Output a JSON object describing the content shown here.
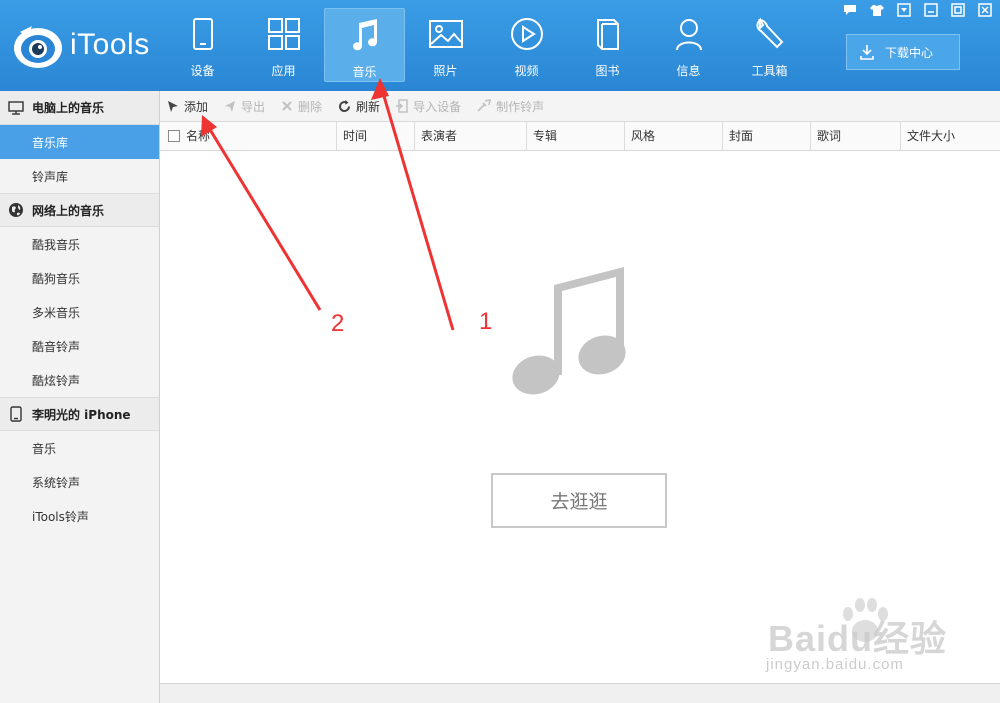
{
  "app": {
    "logo_text": "iTools"
  },
  "nav": [
    {
      "label": "设备",
      "icon": "device-icon"
    },
    {
      "label": "应用",
      "icon": "apps-icon"
    },
    {
      "label": "音乐",
      "icon": "music-note-icon",
      "active": true
    },
    {
      "label": "照片",
      "icon": "photo-icon"
    },
    {
      "label": "视频",
      "icon": "video-play-icon"
    },
    {
      "label": "图书",
      "icon": "book-icon"
    },
    {
      "label": "信息",
      "icon": "user-icon"
    },
    {
      "label": "工具箱",
      "icon": "wrench-icon"
    }
  ],
  "download_center": {
    "label": "下载中心",
    "icon": "download-icon"
  },
  "window_controls": [
    "feedback-icon",
    "skin-icon",
    "menu-icon",
    "minimize-icon",
    "maximize-icon",
    "close-icon"
  ],
  "sidebar": {
    "sections": [
      {
        "title": "电脑上的音乐",
        "icon": "monitor-icon",
        "items": [
          "音乐库",
          "铃声库"
        ],
        "active_index": 0
      },
      {
        "title": "网络上的音乐",
        "icon": "globe-icon",
        "items": [
          "酷我音乐",
          "酷狗音乐",
          "多米音乐",
          "酷音铃声",
          "酷炫铃声"
        ]
      },
      {
        "title": "李明光的 iPhone",
        "icon": "phone-icon",
        "items": [
          "音乐",
          "系统铃声",
          "iTools铃声"
        ]
      }
    ]
  },
  "toolbar": {
    "add": "添加",
    "export": "导出",
    "delete": "删除",
    "refresh": "刷新",
    "import_device": "导入设备",
    "make_ringtone": "制作铃声"
  },
  "columns": [
    "名称",
    "时间",
    "表演者",
    "专辑",
    "风格",
    "封面",
    "歌词",
    "文件大小"
  ],
  "empty_state": {
    "button_label": "去逛逛",
    "icon": "music-note-icon"
  },
  "annotations": {
    "label_1": "1",
    "label_2": "2",
    "color": "#ee3333"
  },
  "watermark": {
    "brand": "Baidu经验",
    "url": "jingyan.baidu.com"
  },
  "colors": {
    "header": "#2f8fdc",
    "active_sidebar": "#4aa0e6",
    "accent_red": "#ee3333"
  }
}
